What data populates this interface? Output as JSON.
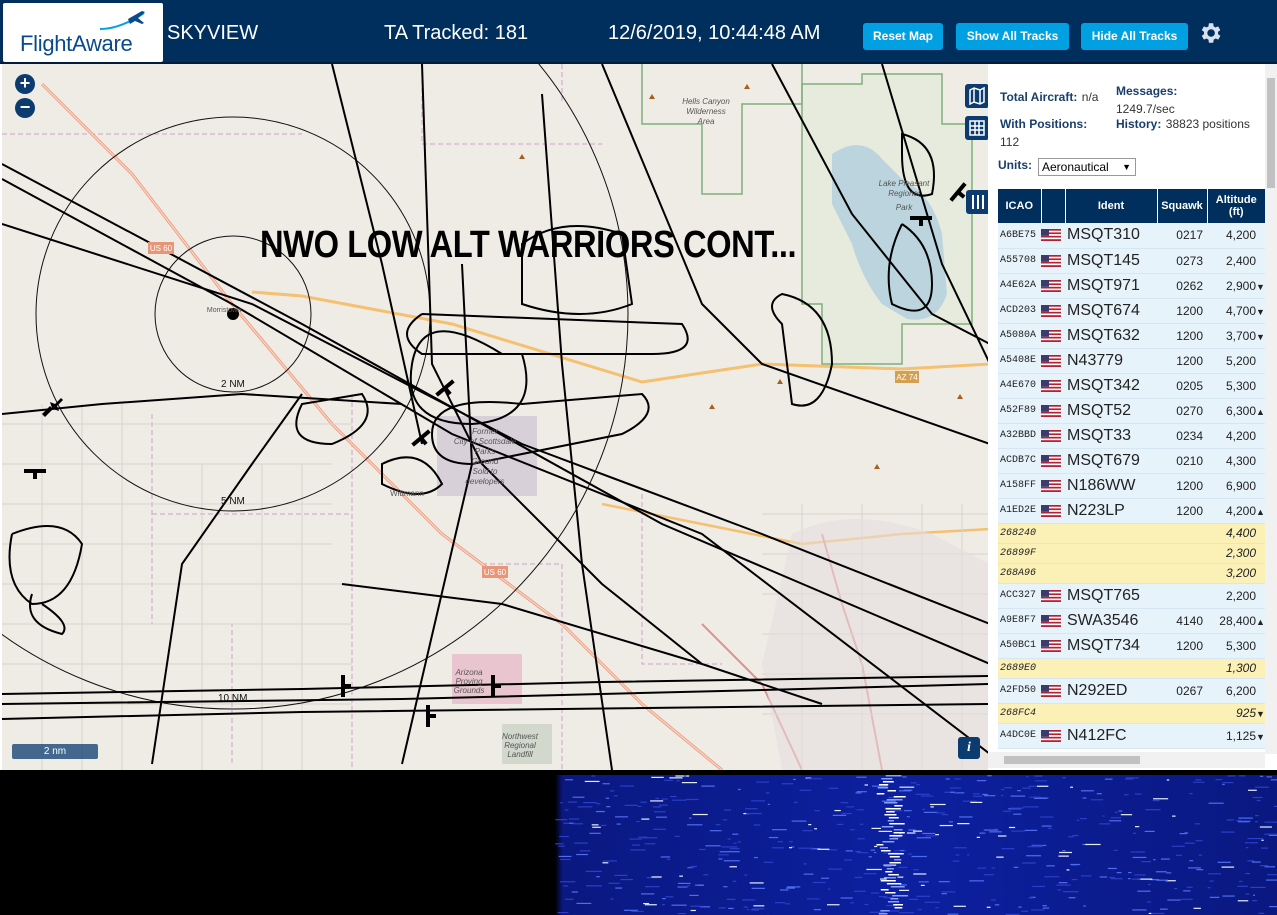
{
  "header": {
    "logo_text": "FlightAware",
    "app_name": "SKYVIEW",
    "tracked": "TA Tracked: 181",
    "datetime": "12/6/2019, 10:44:48 AM",
    "buttons": [
      "Reset Map",
      "Show All Tracks",
      "Hide All Tracks"
    ],
    "settings_icon": "gear-icon",
    "accent": "#00a0e2",
    "bar_color": "#002f5d"
  },
  "map": {
    "overlay_text": "NWO LOW ALT WARRIORS CONT...",
    "zoom_in": "+",
    "zoom_out": "−",
    "range_labels": [
      "2 NM",
      "5 NM",
      "10 NM"
    ],
    "place_labels": [
      "Hells Canyon Wilderness Area",
      "Lake Pleasant Regional Park",
      "Former City of Scottsdale Parks Ground Sold to developers",
      "Wittmann",
      "Morristown",
      "Northwest Regional Landfill",
      "Arizona Proving Grounds",
      "US 60",
      "AZ 74"
    ],
    "scale": "2 nm",
    "info": "i"
  },
  "sidebar": {
    "total_aircraft_label": "Total Aircraft:",
    "total_aircraft_value": "n/a",
    "with_positions_label": "With Positions:",
    "with_positions_value": "112",
    "messages_label": "Messages:",
    "messages_value": "1249.7/sec",
    "history_label": "History:",
    "history_value": "38823 positions",
    "units_label": "Units:",
    "units_value": "Aeronautical",
    "columns": [
      "ICAO",
      "",
      "Ident",
      "Squawk",
      "Altitude (ft)"
    ],
    "rows": [
      {
        "icao": "A6BE75",
        "flag": true,
        "ident": "MSQT310",
        "squawk": "0217",
        "alt": "4,200",
        "trend": ""
      },
      {
        "icao": "A55708",
        "flag": true,
        "ident": "MSQT145",
        "squawk": "0273",
        "alt": "2,400",
        "trend": ""
      },
      {
        "icao": "A4E62A",
        "flag": true,
        "ident": "MSQT971",
        "squawk": "0262",
        "alt": "2,900",
        "trend": "▼"
      },
      {
        "icao": "ACD203",
        "flag": true,
        "ident": "MSQT674",
        "squawk": "1200",
        "alt": "4,700",
        "trend": "▼"
      },
      {
        "icao": "A5080A",
        "flag": true,
        "ident": "MSQT632",
        "squawk": "1200",
        "alt": "3,700",
        "trend": "▼"
      },
      {
        "icao": "A5408E",
        "flag": true,
        "ident": "N43779",
        "squawk": "1200",
        "alt": "5,200",
        "trend": ""
      },
      {
        "icao": "A4E670",
        "flag": true,
        "ident": "MSQT342",
        "squawk": "0205",
        "alt": "5,300",
        "trend": ""
      },
      {
        "icao": "A52F89",
        "flag": true,
        "ident": "MSQT52",
        "squawk": "0270",
        "alt": "6,300",
        "trend": "▲"
      },
      {
        "icao": "A32BBD",
        "flag": true,
        "ident": "MSQT33",
        "squawk": "0234",
        "alt": "4,200",
        "trend": ""
      },
      {
        "icao": "ACDB7C",
        "flag": true,
        "ident": "MSQT679",
        "squawk": "0210",
        "alt": "4,300",
        "trend": ""
      },
      {
        "icao": "A158FF",
        "flag": true,
        "ident": "N186WW",
        "squawk": "1200",
        "alt": "6,900",
        "trend": ""
      },
      {
        "icao": "A1ED2E",
        "flag": true,
        "ident": "N223LP",
        "squawk": "1200",
        "alt": "4,200",
        "trend": "▲"
      },
      {
        "icao": "268240",
        "flag": false,
        "ident": "",
        "squawk": "",
        "alt": "4,400",
        "trend": "",
        "mlat": true
      },
      {
        "icao": "26899F",
        "flag": false,
        "ident": "",
        "squawk": "",
        "alt": "2,300",
        "trend": "",
        "mlat": true
      },
      {
        "icao": "268A96",
        "flag": false,
        "ident": "",
        "squawk": "",
        "alt": "3,200",
        "trend": "",
        "mlat": true
      },
      {
        "icao": "ACC327",
        "flag": true,
        "ident": "MSQT765",
        "squawk": "",
        "alt": "2,200",
        "trend": ""
      },
      {
        "icao": "A9E8F7",
        "flag": true,
        "ident": "SWA3546",
        "squawk": "4140",
        "alt": "28,400",
        "trend": "▲"
      },
      {
        "icao": "A50BC1",
        "flag": true,
        "ident": "MSQT734",
        "squawk": "1200",
        "alt": "5,300",
        "trend": ""
      },
      {
        "icao": "2689E0",
        "flag": false,
        "ident": "",
        "squawk": "",
        "alt": "1,300",
        "trend": "",
        "mlat": true
      },
      {
        "icao": "A2FD50",
        "flag": true,
        "ident": "N292ED",
        "squawk": "0267",
        "alt": "6,200",
        "trend": ""
      },
      {
        "icao": "268FC4",
        "flag": false,
        "ident": "",
        "squawk": "",
        "alt": "925",
        "trend": "▼",
        "mlat": true
      },
      {
        "icao": "A4DC0E",
        "flag": true,
        "ident": "N412FC",
        "squawk": "",
        "alt": "1,125",
        "trend": "▼"
      }
    ]
  }
}
